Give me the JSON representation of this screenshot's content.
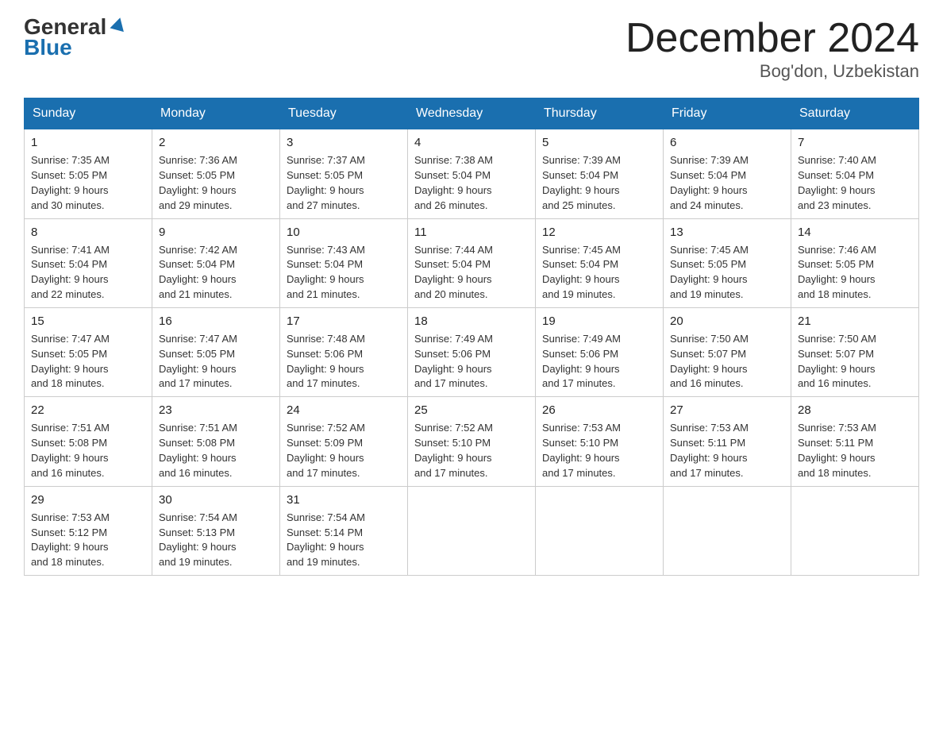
{
  "logo": {
    "general": "General",
    "blue": "Blue"
  },
  "title": "December 2024",
  "subtitle": "Bog'don, Uzbekistan",
  "days_of_week": [
    "Sunday",
    "Monday",
    "Tuesday",
    "Wednesday",
    "Thursday",
    "Friday",
    "Saturday"
  ],
  "weeks": [
    [
      {
        "day": "1",
        "sunrise": "7:35 AM",
        "sunset": "5:05 PM",
        "daylight": "9 hours and 30 minutes."
      },
      {
        "day": "2",
        "sunrise": "7:36 AM",
        "sunset": "5:05 PM",
        "daylight": "9 hours and 29 minutes."
      },
      {
        "day": "3",
        "sunrise": "7:37 AM",
        "sunset": "5:05 PM",
        "daylight": "9 hours and 27 minutes."
      },
      {
        "day": "4",
        "sunrise": "7:38 AM",
        "sunset": "5:04 PM",
        "daylight": "9 hours and 26 minutes."
      },
      {
        "day": "5",
        "sunrise": "7:39 AM",
        "sunset": "5:04 PM",
        "daylight": "9 hours and 25 minutes."
      },
      {
        "day": "6",
        "sunrise": "7:39 AM",
        "sunset": "5:04 PM",
        "daylight": "9 hours and 24 minutes."
      },
      {
        "day": "7",
        "sunrise": "7:40 AM",
        "sunset": "5:04 PM",
        "daylight": "9 hours and 23 minutes."
      }
    ],
    [
      {
        "day": "8",
        "sunrise": "7:41 AM",
        "sunset": "5:04 PM",
        "daylight": "9 hours and 22 minutes."
      },
      {
        "day": "9",
        "sunrise": "7:42 AM",
        "sunset": "5:04 PM",
        "daylight": "9 hours and 21 minutes."
      },
      {
        "day": "10",
        "sunrise": "7:43 AM",
        "sunset": "5:04 PM",
        "daylight": "9 hours and 21 minutes."
      },
      {
        "day": "11",
        "sunrise": "7:44 AM",
        "sunset": "5:04 PM",
        "daylight": "9 hours and 20 minutes."
      },
      {
        "day": "12",
        "sunrise": "7:45 AM",
        "sunset": "5:04 PM",
        "daylight": "9 hours and 19 minutes."
      },
      {
        "day": "13",
        "sunrise": "7:45 AM",
        "sunset": "5:05 PM",
        "daylight": "9 hours and 19 minutes."
      },
      {
        "day": "14",
        "sunrise": "7:46 AM",
        "sunset": "5:05 PM",
        "daylight": "9 hours and 18 minutes."
      }
    ],
    [
      {
        "day": "15",
        "sunrise": "7:47 AM",
        "sunset": "5:05 PM",
        "daylight": "9 hours and 18 minutes."
      },
      {
        "day": "16",
        "sunrise": "7:47 AM",
        "sunset": "5:05 PM",
        "daylight": "9 hours and 17 minutes."
      },
      {
        "day": "17",
        "sunrise": "7:48 AM",
        "sunset": "5:06 PM",
        "daylight": "9 hours and 17 minutes."
      },
      {
        "day": "18",
        "sunrise": "7:49 AM",
        "sunset": "5:06 PM",
        "daylight": "9 hours and 17 minutes."
      },
      {
        "day": "19",
        "sunrise": "7:49 AM",
        "sunset": "5:06 PM",
        "daylight": "9 hours and 17 minutes."
      },
      {
        "day": "20",
        "sunrise": "7:50 AM",
        "sunset": "5:07 PM",
        "daylight": "9 hours and 16 minutes."
      },
      {
        "day": "21",
        "sunrise": "7:50 AM",
        "sunset": "5:07 PM",
        "daylight": "9 hours and 16 minutes."
      }
    ],
    [
      {
        "day": "22",
        "sunrise": "7:51 AM",
        "sunset": "5:08 PM",
        "daylight": "9 hours and 16 minutes."
      },
      {
        "day": "23",
        "sunrise": "7:51 AM",
        "sunset": "5:08 PM",
        "daylight": "9 hours and 16 minutes."
      },
      {
        "day": "24",
        "sunrise": "7:52 AM",
        "sunset": "5:09 PM",
        "daylight": "9 hours and 17 minutes."
      },
      {
        "day": "25",
        "sunrise": "7:52 AM",
        "sunset": "5:10 PM",
        "daylight": "9 hours and 17 minutes."
      },
      {
        "day": "26",
        "sunrise": "7:53 AM",
        "sunset": "5:10 PM",
        "daylight": "9 hours and 17 minutes."
      },
      {
        "day": "27",
        "sunrise": "7:53 AM",
        "sunset": "5:11 PM",
        "daylight": "9 hours and 17 minutes."
      },
      {
        "day": "28",
        "sunrise": "7:53 AM",
        "sunset": "5:11 PM",
        "daylight": "9 hours and 18 minutes."
      }
    ],
    [
      {
        "day": "29",
        "sunrise": "7:53 AM",
        "sunset": "5:12 PM",
        "daylight": "9 hours and 18 minutes."
      },
      {
        "day": "30",
        "sunrise": "7:54 AM",
        "sunset": "5:13 PM",
        "daylight": "9 hours and 19 minutes."
      },
      {
        "day": "31",
        "sunrise": "7:54 AM",
        "sunset": "5:14 PM",
        "daylight": "9 hours and 19 minutes."
      },
      null,
      null,
      null,
      null
    ]
  ]
}
